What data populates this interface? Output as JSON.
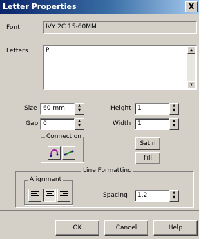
{
  "window": {
    "title": "Letter Properties",
    "close_glyph": "X"
  },
  "font": {
    "label": "Font",
    "value": "IVY 2C 15-60MM"
  },
  "letters": {
    "label": "Letters",
    "value": "P"
  },
  "size": {
    "label": "Size",
    "value": "60 mm"
  },
  "gap": {
    "label": "Gap",
    "value": "0"
  },
  "height": {
    "label": "Height",
    "value": "1"
  },
  "width": {
    "label": "Width",
    "value": "1"
  },
  "connection": {
    "title": "Connection",
    "icons": [
      "arc-connection-icon",
      "line-connection-icon"
    ]
  },
  "buttons": {
    "satin": "Satin",
    "fill": "Fill",
    "ok": "OK",
    "cancel": "Cancel",
    "help": "Help"
  },
  "line_formatting": {
    "title": "Line Formatting",
    "alignment_title": "Alignment",
    "alignment_options": [
      "align-left-icon",
      "align-center-icon",
      "align-right-icon"
    ],
    "spacing_label": "Spacing",
    "spacing_value": "1.2"
  },
  "colors": {
    "title_start": "#0a246a",
    "title_end": "#a6caf0",
    "face": "#d4d0c8",
    "connect_arc": "#a020a0",
    "connect_line": "#208020"
  }
}
